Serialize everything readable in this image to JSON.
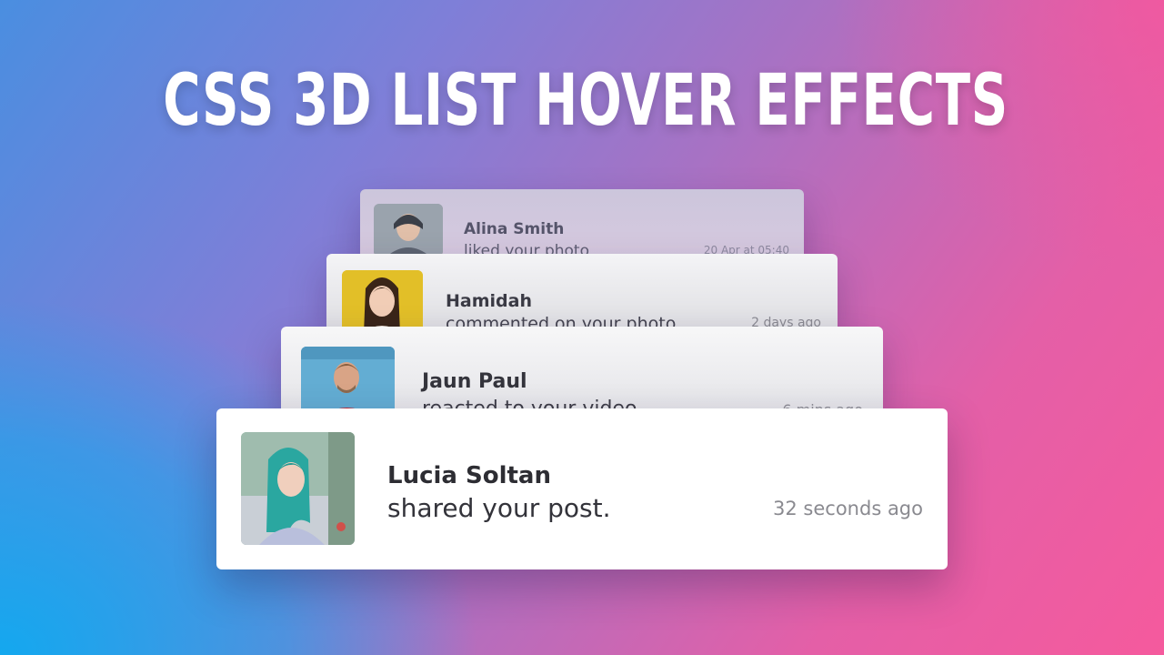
{
  "title": "CSS 3D LIST HOVER EFFECTS",
  "colors": {
    "background_left": "#12a8f0",
    "background_right": "#f55a9d",
    "card_front": "#ffffff",
    "title_text": "#ffffff"
  },
  "notifications": [
    {
      "name": "Lucia Soltan",
      "action": "shared your post.",
      "time": "32 seconds ago",
      "avatar": "user-photo"
    },
    {
      "name": "Jaun Paul",
      "action": "reacted to your video",
      "time": "6 mins ago",
      "avatar": "user-photo"
    },
    {
      "name": "Hamidah",
      "action": "commented on your photo",
      "time": "2 days ago",
      "avatar": "user-photo"
    },
    {
      "name": "Alina Smith",
      "action": "liked your photo",
      "time": "20 Apr at 05:40",
      "avatar": "user-photo"
    }
  ]
}
